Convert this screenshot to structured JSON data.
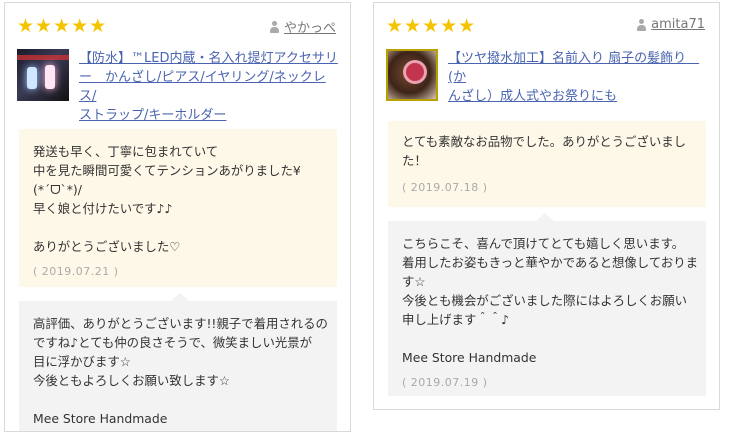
{
  "colors": {
    "star": "#f5c400",
    "link": "#4a64b0",
    "review_bg": "#fdf8e8",
    "reply_bg": "#f3f3f3"
  },
  "icons": {
    "star": "star-icon",
    "user": "user-icon"
  },
  "cards": [
    {
      "stars": "★★★★★",
      "reviewer": "やかっぺ",
      "product_lines": [
        "【防水】™LED内蔵・名入れ提灯アクセサリ",
        "ー　かんざし/ピアス/イヤリング/ネックレス/",
        "ストラップ/キーホルダー"
      ],
      "review_lines": [
        "発送も早く、丁寧に包まれていて",
        "中を見た瞬間可愛くてテンションあがりました¥",
        "(*ˊᗜˋ*)/",
        "早く娘と付けたいです♪♪",
        "",
        "ありがとうございました♡"
      ],
      "review_date": "( 2019.07.21 )",
      "reply_lines": [
        "高評価、ありがとうございます!!親子で着用されるの",
        "ですね♪とても仲の良さそうで、微笑ましい光景が",
        "目に浮かびます☆",
        "今後ともよろしくお願い致します☆",
        "",
        "Mee Store Handmade"
      ]
    },
    {
      "stars": "★★★★★",
      "reviewer": "amita71",
      "product_lines": [
        "【ツヤ撥水加工】名前入り 扇子の髪飾り　(か",
        "んざし）成人式やお祭りにも"
      ],
      "review_lines": [
        "とても素敵なお品物でした。ありがとうございまし",
        "た！"
      ],
      "review_date": "( 2019.07.18 )",
      "reply_lines": [
        "こちらこそ、喜んで頂けてとても嬉しく思います。",
        "着用したお姿もきっと華やかであると想像しておりま",
        "す☆",
        "今後とも機会がございました際にはよろしくお願い",
        "申し上げます＾＾♪",
        "",
        "Mee Store Handmade"
      ],
      "reply_date": "( 2019.07.19 )"
    }
  ]
}
